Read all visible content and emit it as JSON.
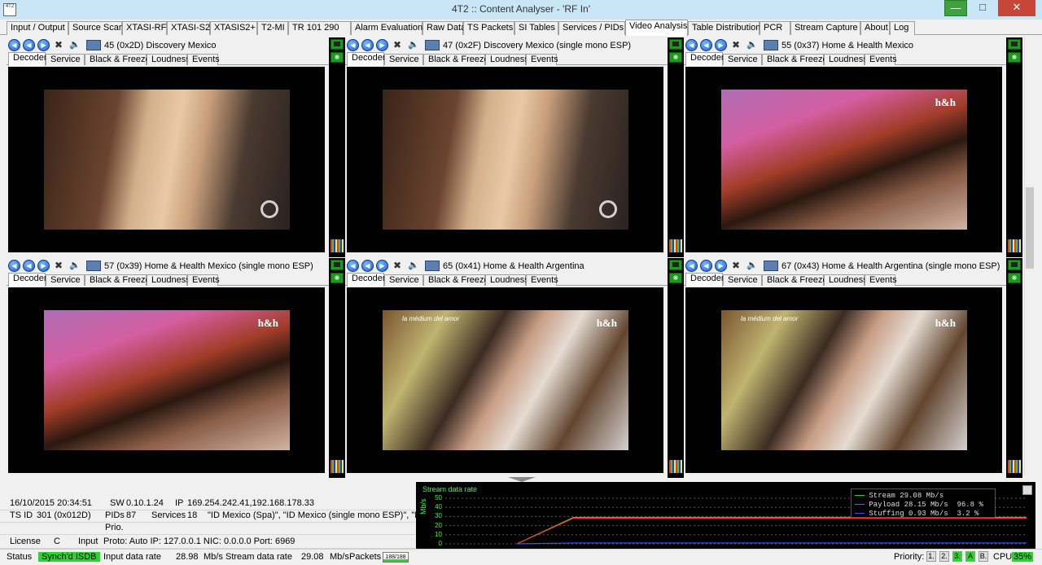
{
  "window": {
    "title": "4T2 :: Content Analyser - 'RF In'",
    "icon_text": "4T2"
  },
  "main_tabs": [
    "Input / Output",
    "Source Scan",
    "XTASI-RF",
    "XTASI-S2",
    "XTASIS2+",
    "T2-MI",
    "TR 101 290",
    "Alarm Evaluation",
    "Raw Data",
    "TS Packets",
    "SI Tables",
    "Services / PIDs",
    "Video Analysis",
    "Table Distribution",
    "PCR",
    "Stream Capture",
    "About",
    "Log"
  ],
  "active_main_tab": "Video Analysis",
  "sub_tabs": [
    "Decoder",
    "Service",
    "Black & Freeze",
    "Loudness",
    "Events"
  ],
  "panes": [
    {
      "service": "45 (0x2D) Discovery Mexico",
      "logo": "D",
      "caption": ""
    },
    {
      "service": "47 (0x2F) Discovery Mexico (single mono ESP)",
      "logo": "D",
      "caption": ""
    },
    {
      "service": "55 (0x37) Home & Health Mexico",
      "logo": "h&h",
      "caption": ""
    },
    {
      "service": "57 (0x39) Home & Health Mexico (single mono ESP)",
      "logo": "h&h",
      "caption": ""
    },
    {
      "service": "65 (0x41) Home & Health Argentina",
      "logo": "h&h",
      "caption": "la médium del amor"
    },
    {
      "service": "67 (0x43) Home & Health Argentina (single mono ESP)",
      "logo": "h&h",
      "caption": "la médium del amor"
    }
  ],
  "info": {
    "datetime": "16/10/2015 20:34:51",
    "sw_label": "SW",
    "sw": "0.10.1.24",
    "ip_label": "IP",
    "ip": "169.254.242.41,192.168.178.33",
    "tsid_label": "TS ID",
    "tsid": "301 (0x012D)",
    "pids_label": "PIDs",
    "pids": "87",
    "services_label": "Services",
    "services": "18",
    "service_list": "\"ID Mexico (Spa)\", \"ID Mexico (single mono ESP)\", \"Dis",
    "prio_label": "Prio.",
    "license_label": "License",
    "license": "C",
    "input_label": "Input",
    "input": "Proto: Auto IP: 127.0.0.1 NIC: 0.0.0.0 Port: 6969"
  },
  "chart_data": {
    "type": "line",
    "title": "Stream data rate",
    "ylabel": "Mb/s",
    "ylim": [
      0,
      50
    ],
    "yticks": [
      "50",
      "40",
      "30",
      "20",
      "10",
      "0"
    ],
    "grid": true,
    "legend_position": "top-right",
    "series": [
      {
        "name": "Stream",
        "value": "29.08 Mb/s",
        "pct": "",
        "color": "#33cc33",
        "values": [
          0,
          29.08,
          29.08,
          29.08,
          29.08,
          29.08,
          29.08,
          29.08,
          29.08,
          29.08
        ]
      },
      {
        "name": "Payload",
        "value": "28.15 Mb/s",
        "pct": "96.8 %",
        "color": "#ff3333",
        "values": [
          0,
          28.15,
          28.15,
          28.15,
          28.15,
          28.15,
          28.15,
          28.15,
          28.15,
          28.15
        ]
      },
      {
        "name": "Stuffing",
        "value": "0.93 Mb/s",
        "pct": "3.2 %",
        "color": "#3355ff",
        "values": [
          0,
          0.93,
          0.93,
          0.93,
          0.93,
          0.93,
          0.93,
          0.93,
          0.93,
          0.93
        ]
      }
    ]
  },
  "status": {
    "status_label": "Status",
    "synch": "Synch'd ISDB",
    "input_rate_label": "Input data rate",
    "input_rate": "28.98",
    "unit1": "Mb/s",
    "stream_rate_label": "Stream data rate",
    "stream_rate": "29.08",
    "unit2": "Mb/s",
    "packets_label": "Packets",
    "packets": "188/188",
    "priority_label": "Priority:",
    "priorities": [
      "1.",
      "2.",
      "3.",
      "A",
      "B."
    ],
    "cpu_label": "CPU",
    "cpu": "35%"
  },
  "colors": {
    "accent_green": "#2bd62b",
    "titlebar": "#c9e6f7"
  }
}
